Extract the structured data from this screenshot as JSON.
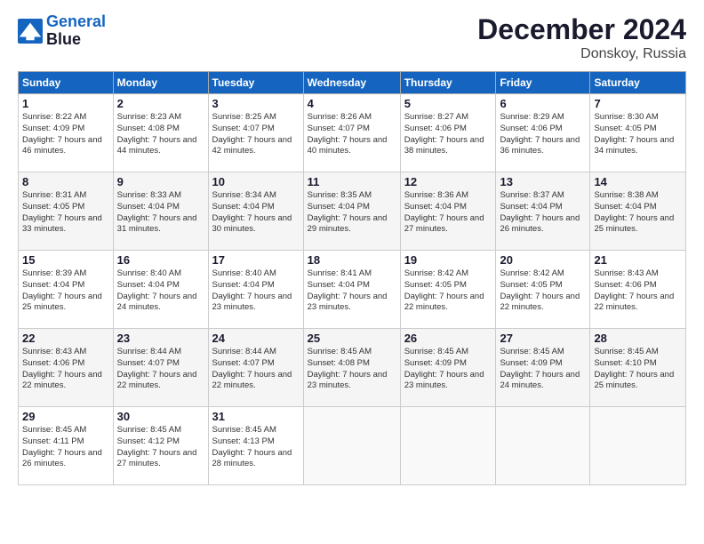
{
  "header": {
    "title": "December 2024",
    "location": "Donskoy, Russia"
  },
  "days": [
    "Sunday",
    "Monday",
    "Tuesday",
    "Wednesday",
    "Thursday",
    "Friday",
    "Saturday"
  ],
  "weeks": [
    [
      {
        "day": "1",
        "sunrise": "Sunrise: 8:22 AM",
        "sunset": "Sunset: 4:09 PM",
        "daylight": "Daylight: 7 hours and 46 minutes."
      },
      {
        "day": "2",
        "sunrise": "Sunrise: 8:23 AM",
        "sunset": "Sunset: 4:08 PM",
        "daylight": "Daylight: 7 hours and 44 minutes."
      },
      {
        "day": "3",
        "sunrise": "Sunrise: 8:25 AM",
        "sunset": "Sunset: 4:07 PM",
        "daylight": "Daylight: 7 hours and 42 minutes."
      },
      {
        "day": "4",
        "sunrise": "Sunrise: 8:26 AM",
        "sunset": "Sunset: 4:07 PM",
        "daylight": "Daylight: 7 hours and 40 minutes."
      },
      {
        "day": "5",
        "sunrise": "Sunrise: 8:27 AM",
        "sunset": "Sunset: 4:06 PM",
        "daylight": "Daylight: 7 hours and 38 minutes."
      },
      {
        "day": "6",
        "sunrise": "Sunrise: 8:29 AM",
        "sunset": "Sunset: 4:06 PM",
        "daylight": "Daylight: 7 hours and 36 minutes."
      },
      {
        "day": "7",
        "sunrise": "Sunrise: 8:30 AM",
        "sunset": "Sunset: 4:05 PM",
        "daylight": "Daylight: 7 hours and 34 minutes."
      }
    ],
    [
      {
        "day": "8",
        "sunrise": "Sunrise: 8:31 AM",
        "sunset": "Sunset: 4:05 PM",
        "daylight": "Daylight: 7 hours and 33 minutes."
      },
      {
        "day": "9",
        "sunrise": "Sunrise: 8:33 AM",
        "sunset": "Sunset: 4:04 PM",
        "daylight": "Daylight: 7 hours and 31 minutes."
      },
      {
        "day": "10",
        "sunrise": "Sunrise: 8:34 AM",
        "sunset": "Sunset: 4:04 PM",
        "daylight": "Daylight: 7 hours and 30 minutes."
      },
      {
        "day": "11",
        "sunrise": "Sunrise: 8:35 AM",
        "sunset": "Sunset: 4:04 PM",
        "daylight": "Daylight: 7 hours and 29 minutes."
      },
      {
        "day": "12",
        "sunrise": "Sunrise: 8:36 AM",
        "sunset": "Sunset: 4:04 PM",
        "daylight": "Daylight: 7 hours and 27 minutes."
      },
      {
        "day": "13",
        "sunrise": "Sunrise: 8:37 AM",
        "sunset": "Sunset: 4:04 PM",
        "daylight": "Daylight: 7 hours and 26 minutes."
      },
      {
        "day": "14",
        "sunrise": "Sunrise: 8:38 AM",
        "sunset": "Sunset: 4:04 PM",
        "daylight": "Daylight: 7 hours and 25 minutes."
      }
    ],
    [
      {
        "day": "15",
        "sunrise": "Sunrise: 8:39 AM",
        "sunset": "Sunset: 4:04 PM",
        "daylight": "Daylight: 7 hours and 25 minutes."
      },
      {
        "day": "16",
        "sunrise": "Sunrise: 8:40 AM",
        "sunset": "Sunset: 4:04 PM",
        "daylight": "Daylight: 7 hours and 24 minutes."
      },
      {
        "day": "17",
        "sunrise": "Sunrise: 8:40 AM",
        "sunset": "Sunset: 4:04 PM",
        "daylight": "Daylight: 7 hours and 23 minutes."
      },
      {
        "day": "18",
        "sunrise": "Sunrise: 8:41 AM",
        "sunset": "Sunset: 4:04 PM",
        "daylight": "Daylight: 7 hours and 23 minutes."
      },
      {
        "day": "19",
        "sunrise": "Sunrise: 8:42 AM",
        "sunset": "Sunset: 4:05 PM",
        "daylight": "Daylight: 7 hours and 22 minutes."
      },
      {
        "day": "20",
        "sunrise": "Sunrise: 8:42 AM",
        "sunset": "Sunset: 4:05 PM",
        "daylight": "Daylight: 7 hours and 22 minutes."
      },
      {
        "day": "21",
        "sunrise": "Sunrise: 8:43 AM",
        "sunset": "Sunset: 4:06 PM",
        "daylight": "Daylight: 7 hours and 22 minutes."
      }
    ],
    [
      {
        "day": "22",
        "sunrise": "Sunrise: 8:43 AM",
        "sunset": "Sunset: 4:06 PM",
        "daylight": "Daylight: 7 hours and 22 minutes."
      },
      {
        "day": "23",
        "sunrise": "Sunrise: 8:44 AM",
        "sunset": "Sunset: 4:07 PM",
        "daylight": "Daylight: 7 hours and 22 minutes."
      },
      {
        "day": "24",
        "sunrise": "Sunrise: 8:44 AM",
        "sunset": "Sunset: 4:07 PM",
        "daylight": "Daylight: 7 hours and 22 minutes."
      },
      {
        "day": "25",
        "sunrise": "Sunrise: 8:45 AM",
        "sunset": "Sunset: 4:08 PM",
        "daylight": "Daylight: 7 hours and 23 minutes."
      },
      {
        "day": "26",
        "sunrise": "Sunrise: 8:45 AM",
        "sunset": "Sunset: 4:09 PM",
        "daylight": "Daylight: 7 hours and 23 minutes."
      },
      {
        "day": "27",
        "sunrise": "Sunrise: 8:45 AM",
        "sunset": "Sunset: 4:09 PM",
        "daylight": "Daylight: 7 hours and 24 minutes."
      },
      {
        "day": "28",
        "sunrise": "Sunrise: 8:45 AM",
        "sunset": "Sunset: 4:10 PM",
        "daylight": "Daylight: 7 hours and 25 minutes."
      }
    ],
    [
      {
        "day": "29",
        "sunrise": "Sunrise: 8:45 AM",
        "sunset": "Sunset: 4:11 PM",
        "daylight": "Daylight: 7 hours and 26 minutes."
      },
      {
        "day": "30",
        "sunrise": "Sunrise: 8:45 AM",
        "sunset": "Sunset: 4:12 PM",
        "daylight": "Daylight: 7 hours and 27 minutes."
      },
      {
        "day": "31",
        "sunrise": "Sunrise: 8:45 AM",
        "sunset": "Sunset: 4:13 PM",
        "daylight": "Daylight: 7 hours and 28 minutes."
      },
      null,
      null,
      null,
      null
    ]
  ]
}
